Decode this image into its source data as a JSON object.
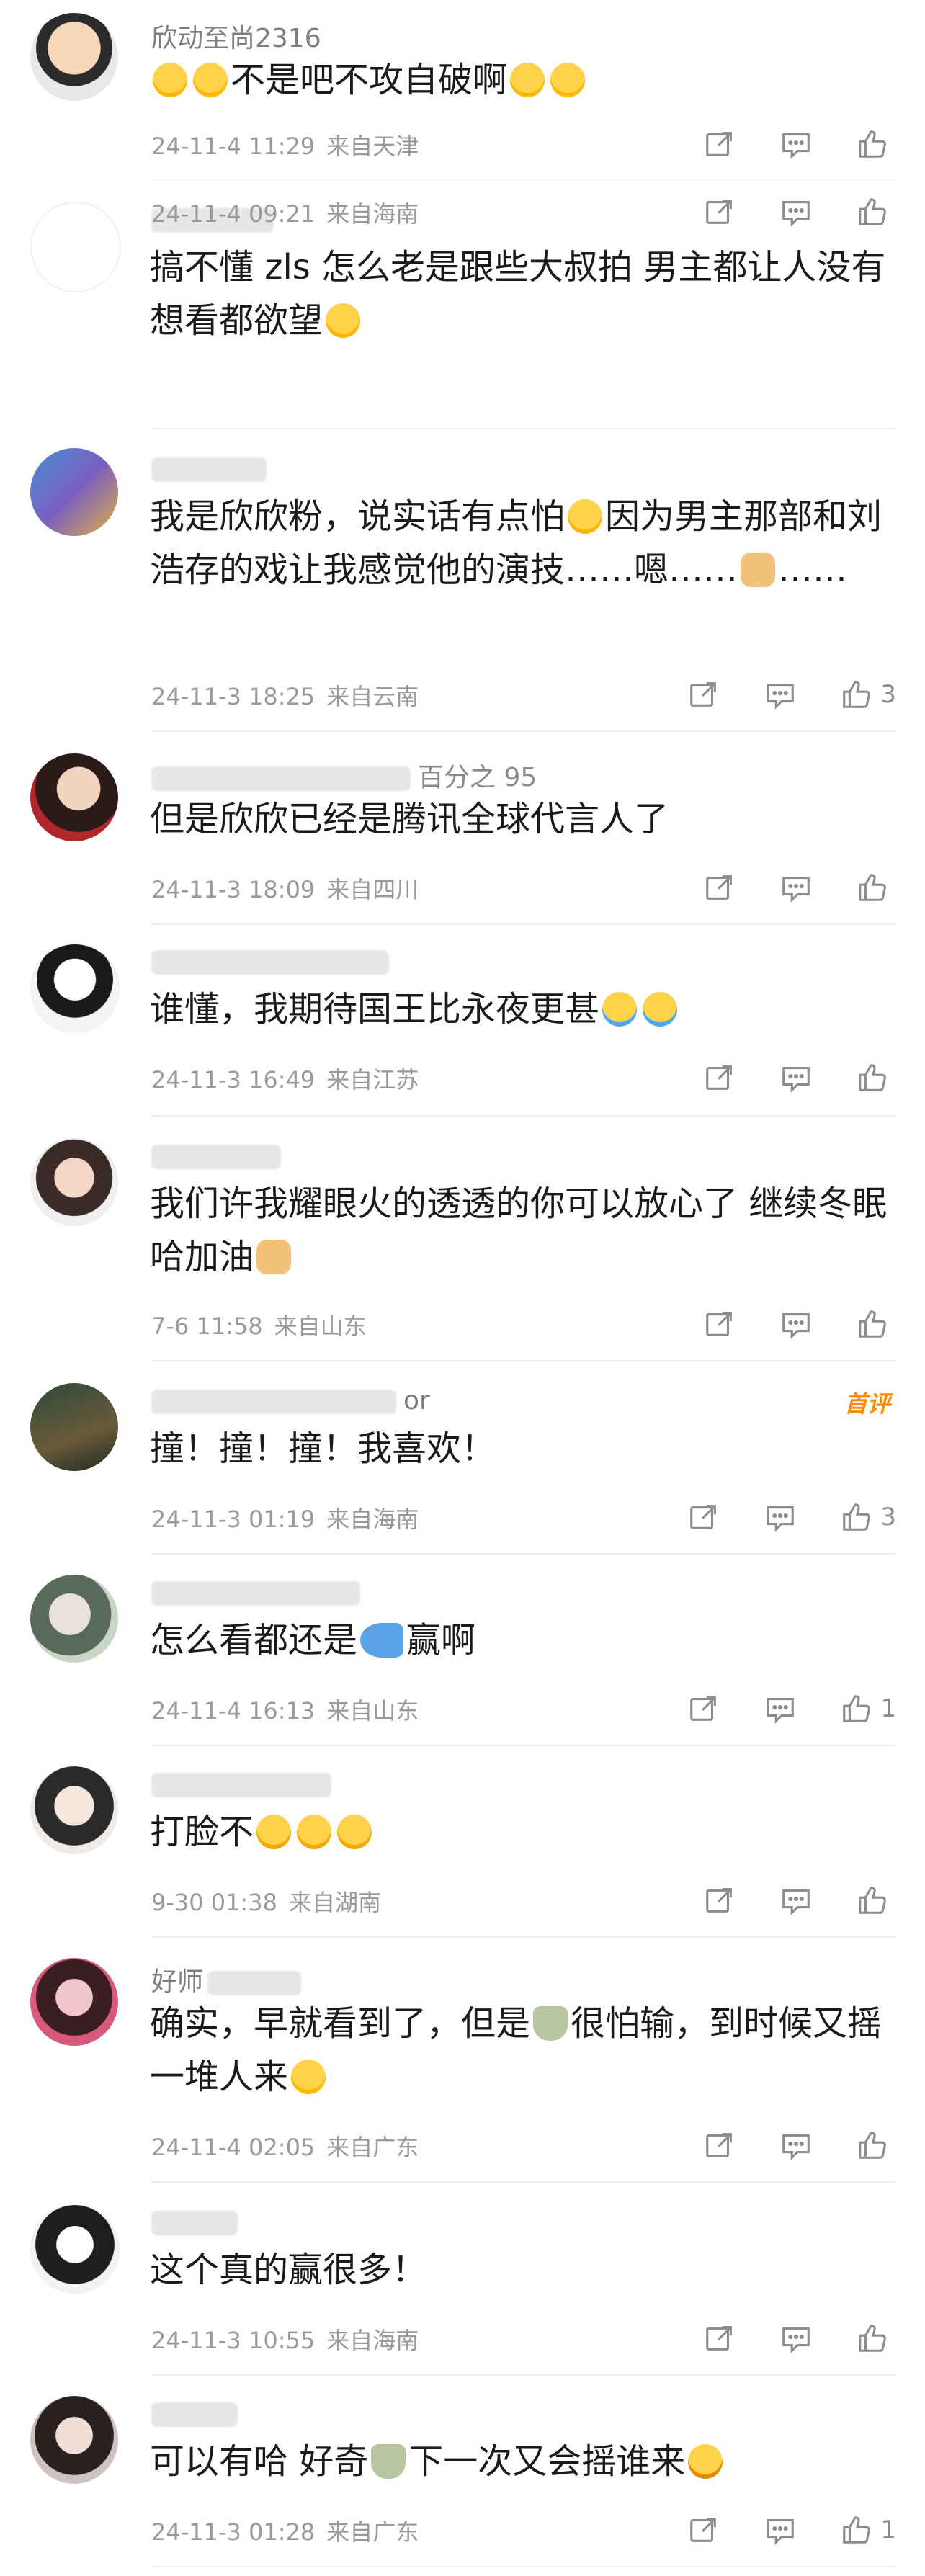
{
  "comments": [
    {
      "name": "欣动至尚2316",
      "text": [
        "😂",
        "😂",
        "不是吧不攻自破啊",
        "😂",
        "😂"
      ],
      "date": "24-11-4 11:29",
      "location": "来自天津",
      "likes": ""
    },
    {
      "name": "",
      "text": [
        "搞不懂 zls 怎么老是跟些大叔拍 男主都让人没有想看都欲望",
        "😂"
      ],
      "date": "24-11-4 09:21",
      "location": "来自海南",
      "likes": ""
    },
    {
      "name": "",
      "text": [
        "我是欣欣粉，说实话有点怕",
        "😂",
        "因为男主那部和刘浩存的戏让我感觉他的演技……嗯……",
        "🐶",
        "……"
      ],
      "date": "24-11-3 18:25",
      "location": "来自云南",
      "likes": "3"
    },
    {
      "name": "百分之 95",
      "text": [
        "但是欣欣已经是腾讯全球代言人了"
      ],
      "date": "24-11-3 18:09",
      "location": "来自四川",
      "likes": ""
    },
    {
      "name": "",
      "text": [
        "谁懂，我期待国王比永夜更甚",
        "😭",
        "😭"
      ],
      "date": "24-11-3 16:49",
      "location": "来自江苏",
      "likes": ""
    },
    {
      "name": "",
      "text": [
        "我们许我耀眼火的透透的你可以放心了 继续冬眠哈加油",
        "🐶"
      ],
      "date": "7-6 11:58",
      "location": "来自山东",
      "likes": ""
    },
    {
      "name": "or",
      "badge": "首评",
      "text": [
        "撞！撞！撞！我喜欢！"
      ],
      "date": "24-11-3 01:19",
      "location": "来自海南",
      "likes": "3"
    },
    {
      "name": "",
      "text": [
        "怎么看都还是",
        "🐟",
        "赢啊"
      ],
      "date": "24-11-4 16:13",
      "location": "来自山东",
      "likes": "1"
    },
    {
      "name": "",
      "text": [
        "打脸不",
        "😊",
        "😊",
        "😊"
      ],
      "date": "9-30 01:38",
      "location": "来自湖南",
      "likes": ""
    },
    {
      "name": "好师",
      "text": [
        "确实，早就看到了，但是",
        "🍵",
        "很怕输，到时候又摇一堆人来",
        "😂"
      ],
      "date": "24-11-4 02:05",
      "location": "来自广东",
      "likes": ""
    },
    {
      "name": "",
      "text": [
        "这个真的赢很多！"
      ],
      "date": "24-11-3 10:55",
      "location": "来自海南",
      "likes": ""
    },
    {
      "name": "",
      "text": [
        "可以有哈 好奇",
        "🍵",
        "下一次又会摇谁来",
        "😮"
      ],
      "date": "24-11-3 01:28",
      "location": "来自广东",
      "likes": "1"
    }
  ],
  "colors": {
    "meta": "#9a9a9a",
    "icon": "#8c8c8c",
    "badge": "#ff8a00",
    "divider": "#efefef"
  },
  "icons": {
    "share": "share-icon",
    "comment": "comment-icon",
    "like": "thumbs-up-icon"
  }
}
